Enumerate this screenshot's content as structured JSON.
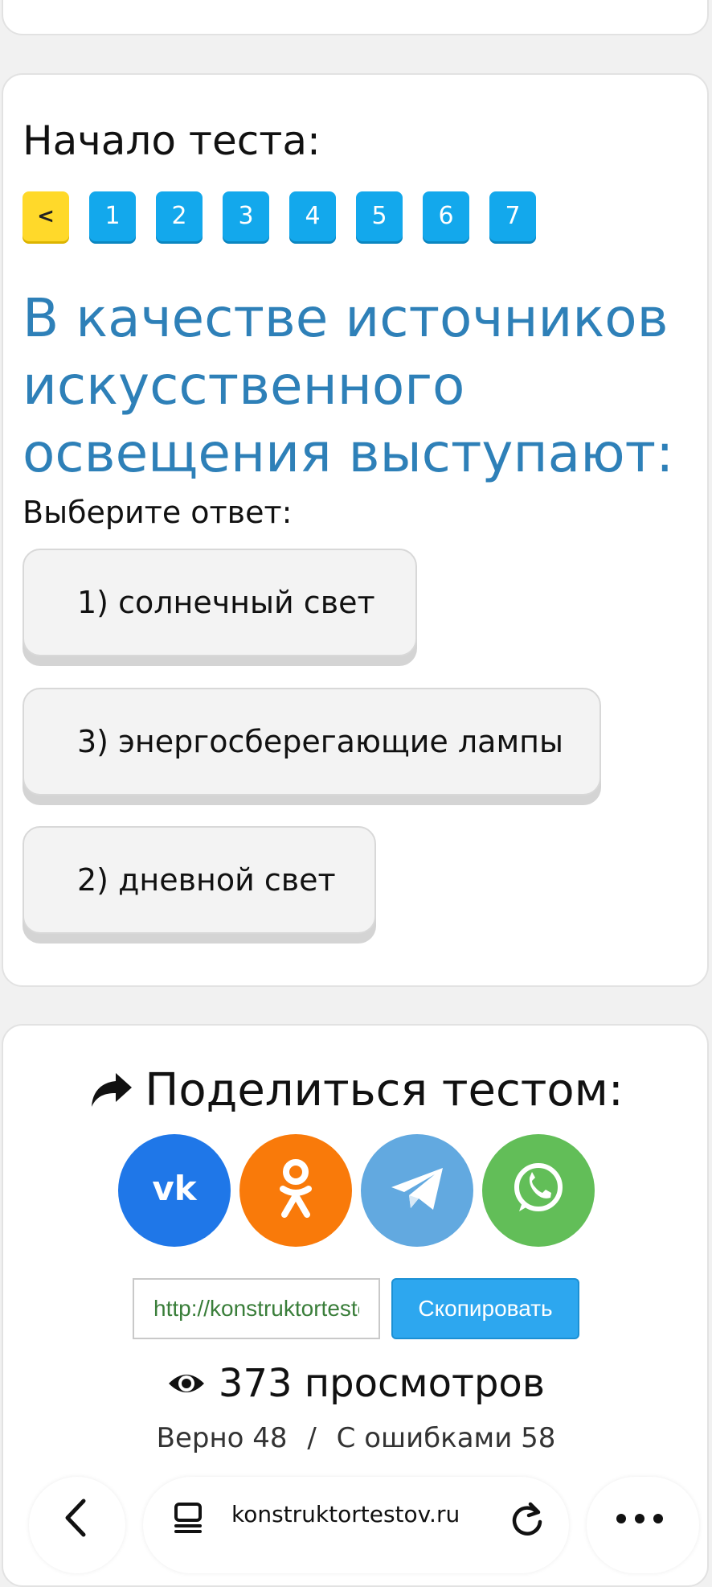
{
  "quiz": {
    "start_title": "Начало теста:",
    "prev_label": "<",
    "pages": [
      "1",
      "2",
      "3",
      "4",
      "5",
      "6",
      "7"
    ],
    "question": "В качестве источников искусственного освещения выступают:",
    "hint": "Выберите ответ:",
    "answers": [
      "1) солнечный свет",
      "3) энергосберегающие лампы",
      "2) дневной свет"
    ]
  },
  "share": {
    "title": "Поделиться тестом:",
    "socials": [
      "vk-icon",
      "odnoklassniki-icon",
      "telegram-icon",
      "whatsapp-icon"
    ],
    "link_value": "http://konstruktortestov.ru",
    "copy_label": "Скопировать",
    "views": "373 просмотров",
    "correct": "Верно 48",
    "separator": "/",
    "wrong": "С ошибками 58"
  },
  "browser": {
    "url": "konstruktortestov.ru"
  },
  "colors": {
    "page_button": "#13a8ec",
    "prev_button": "#ffd92a",
    "question_text": "#2e80b8",
    "vk": "#1f77e8",
    "ok": "#f97a0a",
    "telegram": "#62a9e0",
    "whatsapp": "#62be58",
    "copy_button": "#2da7ef"
  }
}
